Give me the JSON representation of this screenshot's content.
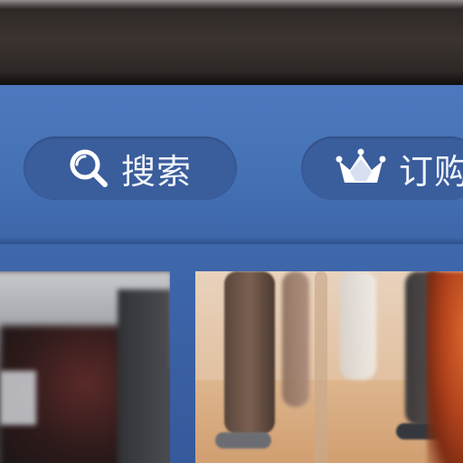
{
  "header": {
    "buttons": [
      {
        "id": "search",
        "label": "搜索",
        "icon": "search-icon"
      },
      {
        "id": "subscribe",
        "label": "订购",
        "icon": "crown-icon"
      }
    ]
  },
  "colors": {
    "screen_bg": "#4470b4",
    "pill_bg": "#3a5d9c",
    "pill_text": "#f2f5fb",
    "bezel": "#2e2826"
  }
}
